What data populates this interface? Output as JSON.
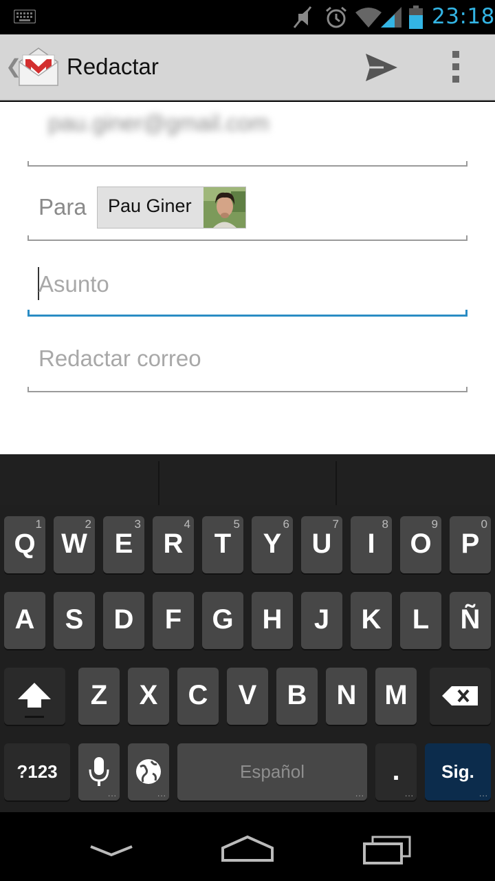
{
  "status_bar": {
    "time": "23:18",
    "icons": [
      "keyboard-icon",
      "mute-icon",
      "alarm-icon",
      "wifi-icon",
      "signal-icon",
      "battery-icon"
    ],
    "time_color": "#33b5e5"
  },
  "action_bar": {
    "title": "Redactar",
    "back_glyph": "❮",
    "app_icon": "gmail-icon",
    "send_icon": "send-icon",
    "overflow_icon": "overflow-menu-icon"
  },
  "compose": {
    "from_value": "pau.giner@gmail.com",
    "to_label": "Para",
    "recipients": [
      {
        "name": "Pau Giner"
      }
    ],
    "subject_placeholder": "Asunto",
    "body_placeholder": "Redactar correo",
    "focus_color": "#2a8cc4"
  },
  "keyboard": {
    "row1": [
      {
        "label": "Q",
        "num": "1"
      },
      {
        "label": "W",
        "num": "2"
      },
      {
        "label": "E",
        "num": "3"
      },
      {
        "label": "R",
        "num": "4"
      },
      {
        "label": "T",
        "num": "5"
      },
      {
        "label": "Y",
        "num": "6"
      },
      {
        "label": "U",
        "num": "7"
      },
      {
        "label": "I",
        "num": "8"
      },
      {
        "label": "O",
        "num": "9"
      },
      {
        "label": "P",
        "num": "0"
      }
    ],
    "row2": [
      "A",
      "S",
      "D",
      "F",
      "G",
      "H",
      "J",
      "K",
      "L",
      "Ñ"
    ],
    "row3": [
      "Z",
      "X",
      "C",
      "V",
      "B",
      "N",
      "M"
    ],
    "symbols_label": "?123",
    "space_label": "Español",
    "period_label": ".",
    "action_label": "Sig.",
    "more_glyph": "..."
  },
  "nav_bar": {
    "icons": [
      "back-icon",
      "home-icon",
      "recent-apps-icon"
    ]
  }
}
